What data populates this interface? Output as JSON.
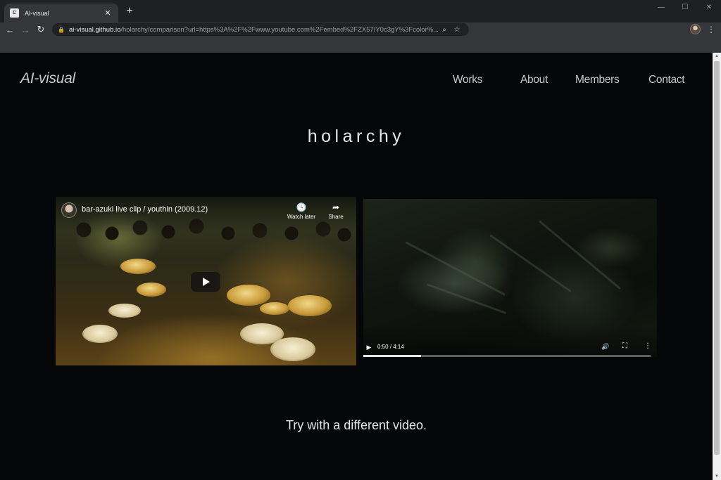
{
  "browser": {
    "tab_title": "AI-visual",
    "favicon_text": "C",
    "url_host": "ai-visual.github.io",
    "url_rest": "/holarchy/comparison?url=https%3A%2F%2Fwww.youtube.com%2Fembed%2FZX57IY0c3gY%3Fcolor%...",
    "icons": {
      "back": "arrow-left-icon",
      "forward": "arrow-right-icon",
      "reload": "reload-icon",
      "lock": "lock-icon",
      "zoom": "search-icon",
      "bookmark": "star-icon",
      "menu": "three-dots-icon"
    }
  },
  "site": {
    "logo": "AI-visual",
    "nav": {
      "works": "Works",
      "about": "About",
      "members": "Members",
      "contact": "Contact"
    },
    "title": "holarchy"
  },
  "youtube_embed": {
    "title": "bar-azuki live clip / youthin (2009.12)",
    "watch_later": "Watch later",
    "share": "Share"
  },
  "video_player": {
    "time": "0:50 / 4:14",
    "progress_fraction": 0.2
  },
  "footer_prompt": "Try with a different video."
}
